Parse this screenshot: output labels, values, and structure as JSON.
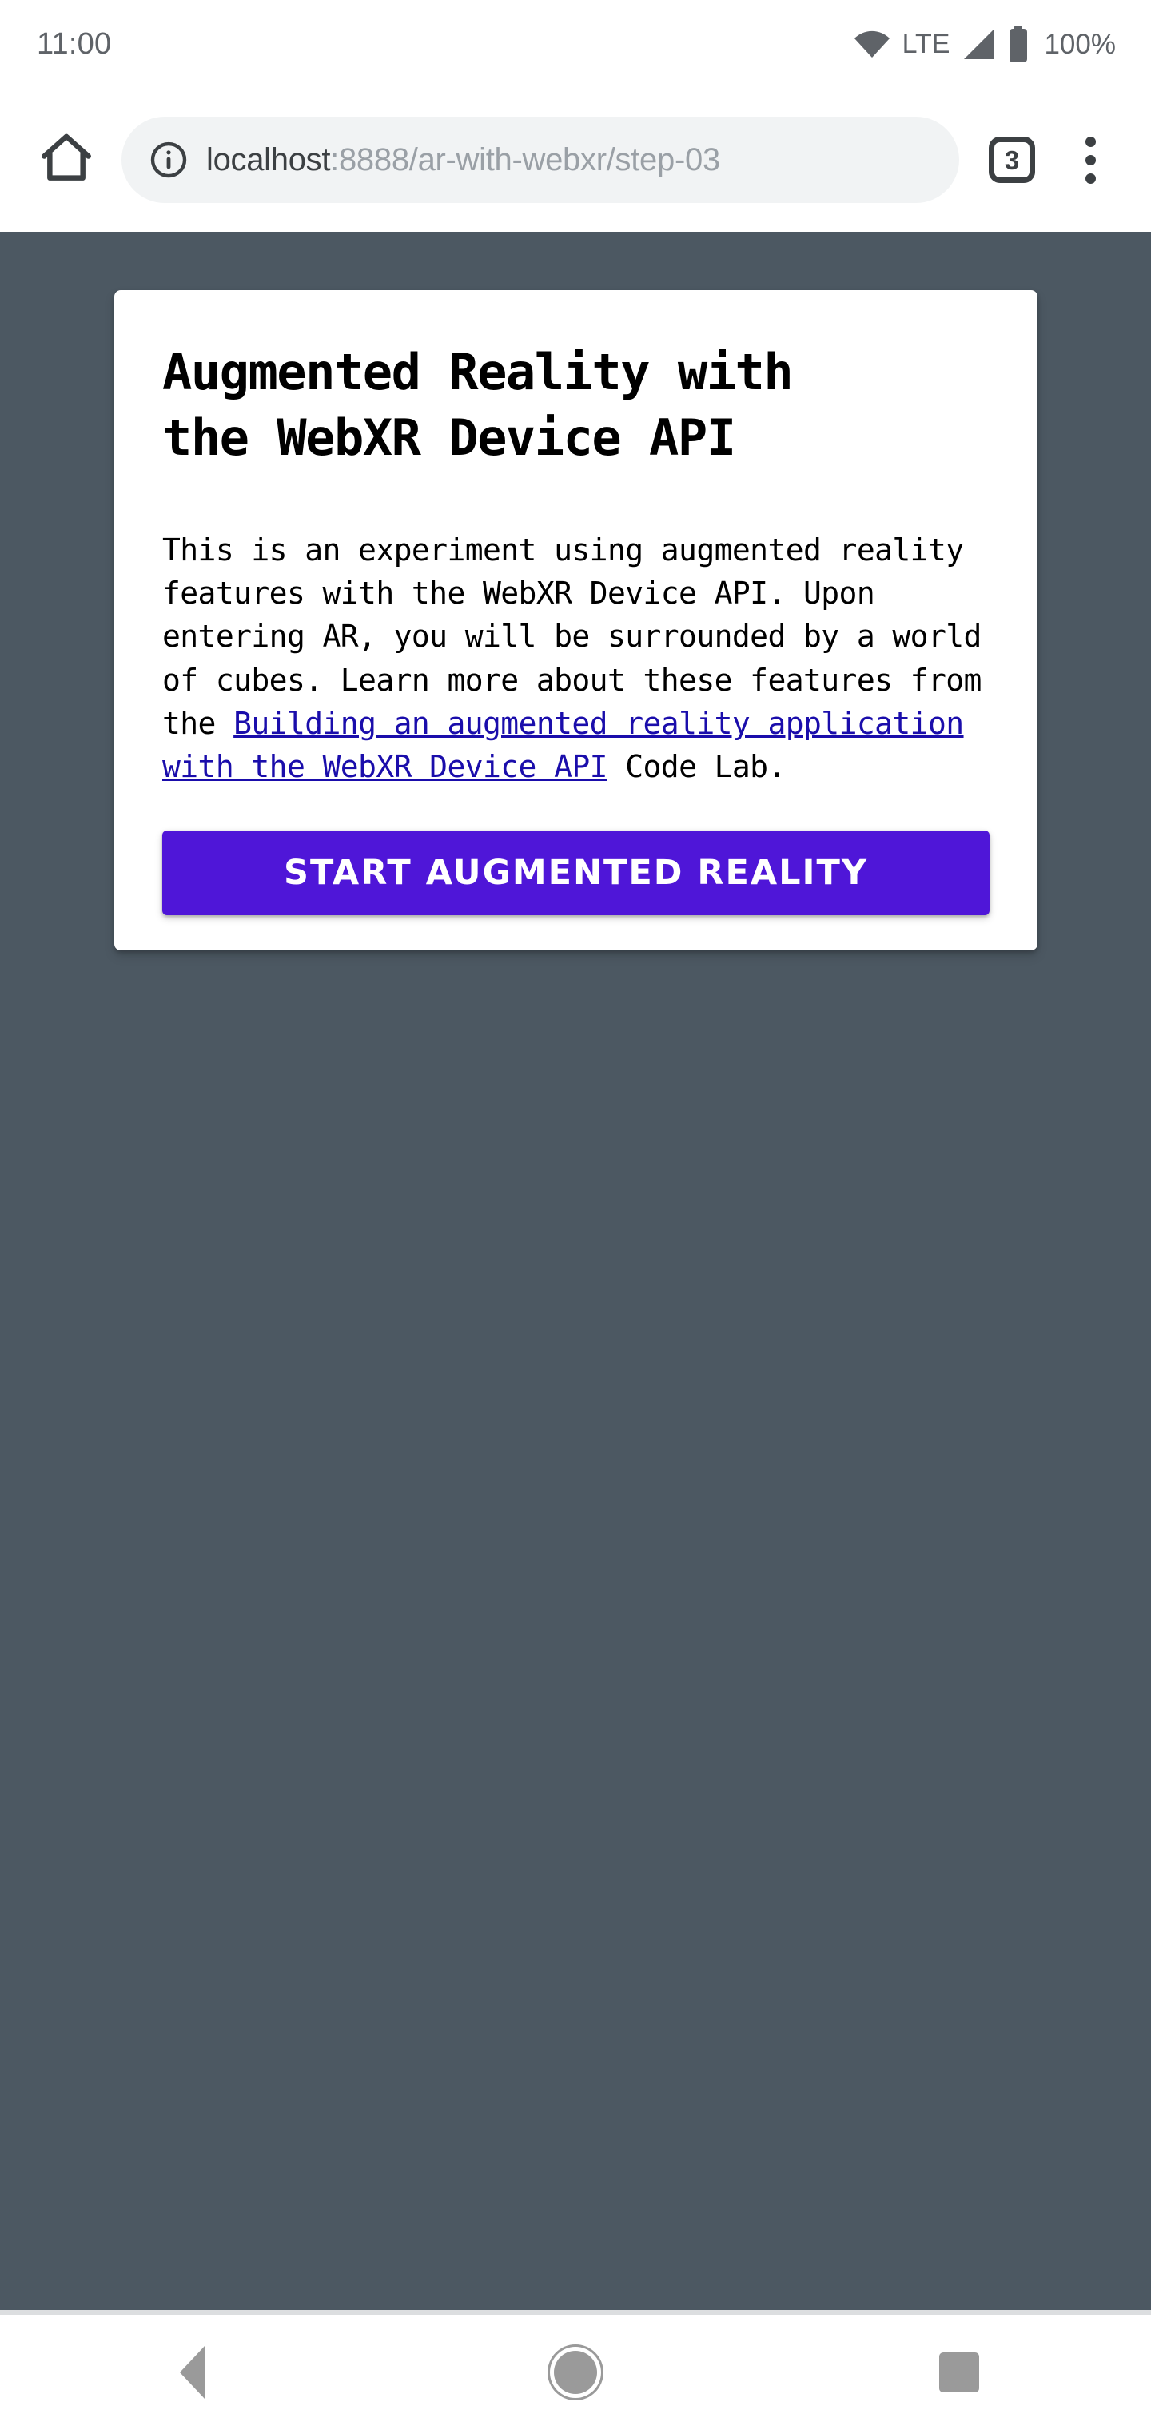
{
  "status_bar": {
    "clock": "11:00",
    "network_label": "LTE",
    "battery_label": "100%",
    "icons": [
      "wifi-icon",
      "signal-icon",
      "battery-icon"
    ]
  },
  "browser": {
    "home_icon": "home-icon",
    "security_icon": "info-circle-icon",
    "url_host": "localhost",
    "url_path": ":8888/ar-with-webxr/step-03",
    "url_full": "localhost:8888/ar-with-webxr/step-03",
    "tab_count": "3",
    "menu_icon": "three-dot-menu-icon"
  },
  "page": {
    "background_color": "#4c5862",
    "card": {
      "title": "Augmented Reality with\nthe WebXR Device API",
      "paragraph_part_1": "This is an experiment using augmented reality features with the WebXR Device API. Upon entering AR, you will be surrounded by a world of cubes. Learn more about these features from the ",
      "link_text": "Building an augmented reality application with the WebXR Device API",
      "link_color": "#1a0dab",
      "paragraph_part_2": " Code Lab.",
      "button_label": "START AUGMENTED REALITY",
      "button_color": "#4f16d8"
    }
  },
  "nav_bar": {
    "back_label": "back-icon",
    "home_label": "home-circle-icon",
    "recents_label": "recents-square-icon"
  }
}
